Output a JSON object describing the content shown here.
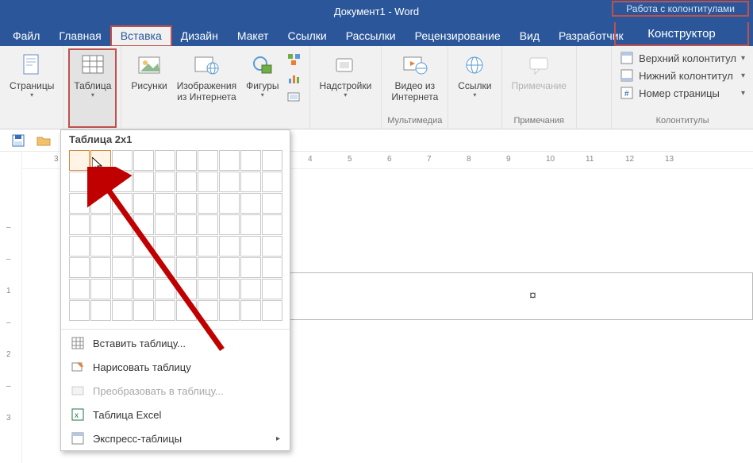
{
  "title": "Документ1 - Word",
  "contextual_group_label": "Работа с колонтитулами",
  "tabs": {
    "file": "Файл",
    "home": "Главная",
    "insert": "Вставка",
    "design": "Дизайн",
    "layout": "Макет",
    "references": "Ссылки",
    "mailings": "Рассылки",
    "review": "Рецензирование",
    "view": "Вид",
    "developer": "Разработчик",
    "designer": "Конструктор"
  },
  "ribbon": {
    "pages": "Страницы",
    "table": "Таблица",
    "pictures": "Рисунки",
    "online_pictures_l1": "Изображения",
    "online_pictures_l2": "из Интернета",
    "shapes": "Фигуры",
    "addins": "Надстройки",
    "video_l1": "Видео из",
    "video_l2": "Интернета",
    "links": "Ссылки",
    "comment": "Примечание",
    "group_media": "Мультимедиа",
    "group_comments": "Примечания",
    "group_hf": "Колонтитулы",
    "hf_header": "Верхний колонтитул",
    "hf_footer": "Нижний колонтитул",
    "hf_pagenum": "Номер страницы"
  },
  "ruler_left_num": "3",
  "ruler_marks": [
    "3",
    "4",
    "5",
    "6",
    "7",
    "8",
    "9",
    "10",
    "11",
    "12",
    "13"
  ],
  "doc_mark": "¤",
  "table_dropdown": {
    "title": "Таблица 2x1",
    "selected_cols": 2,
    "selected_rows": 1,
    "grid_cols": 10,
    "grid_rows": 8,
    "insert_table": "Вставить таблицу...",
    "draw_table": "Нарисовать таблицу",
    "convert": "Преобразовать в таблицу...",
    "excel": "Таблица Excel",
    "quick": "Экспресс-таблицы"
  }
}
